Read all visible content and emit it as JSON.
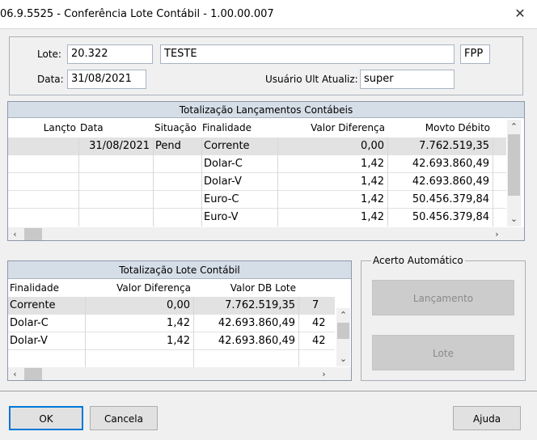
{
  "window": {
    "title": "06.9.5525 - Conferência Lote Contábil - 1.00.00.007"
  },
  "header": {
    "lote_label": "Lote:",
    "lote_value": "20.322",
    "desc_value": "TESTE",
    "code_value": "FPP",
    "data_label": "Data:",
    "data_value": "31/08/2021",
    "usuario_label": "Usuário Ult Atualiz:",
    "usuario_value": "super"
  },
  "lancamentos": {
    "title": "Totalização Lançamentos Contábeis",
    "columns": [
      "Lançto",
      "Data",
      "Situação",
      "Finalidade",
      "Valor Diferença",
      "Movto Débito"
    ],
    "rows": [
      {
        "lancto": "",
        "data": "31/08/2021",
        "situacao": "Pend",
        "finalidade": "Corrente",
        "valor_diferenca": "0,00",
        "movto_debito": "7.762.519,35"
      },
      {
        "lancto": "",
        "data": "",
        "situacao": "",
        "finalidade": "Dolar-C",
        "valor_diferenca": "1,42",
        "movto_debito": "42.693.860,49"
      },
      {
        "lancto": "",
        "data": "",
        "situacao": "",
        "finalidade": "Dolar-V",
        "valor_diferenca": "1,42",
        "movto_debito": "42.693.860,49"
      },
      {
        "lancto": "",
        "data": "",
        "situacao": "",
        "finalidade": "Euro-C",
        "valor_diferenca": "1,42",
        "movto_debito": "50.456.379,84"
      },
      {
        "lancto": "",
        "data": "",
        "situacao": "",
        "finalidade": "Euro-V",
        "valor_diferenca": "1,42",
        "movto_debito": "50.456.379,84"
      }
    ]
  },
  "lote_contabil": {
    "title": "Totalização Lote Contábil",
    "columns": [
      "Finalidade",
      "Valor Diferença",
      "Valor DB Lote"
    ],
    "rows": [
      {
        "finalidade": "Corrente",
        "valor_diferenca": "0,00",
        "valor_db_lote": "7.762.519,35",
        "extra": "7"
      },
      {
        "finalidade": "Dolar-C",
        "valor_diferenca": "1,42",
        "valor_db_lote": "42.693.860,49",
        "extra": "42"
      },
      {
        "finalidade": "Dolar-V",
        "valor_diferenca": "1,42",
        "valor_db_lote": "42.693.860,49",
        "extra": "42"
      }
    ]
  },
  "acerto": {
    "legend": "Acerto Automático",
    "lancamento_label": "Lançamento",
    "lote_label": "Lote"
  },
  "footer": {
    "ok_label": "OK",
    "cancela_label": "Cancela",
    "ajuda_label": "Ajuda"
  },
  "icons": {
    "close": "close-icon",
    "scroll_up": "chevron-up-icon",
    "scroll_down": "chevron-down-icon",
    "scroll_left": "chevron-left-icon",
    "scroll_right": "chevron-right-icon"
  }
}
